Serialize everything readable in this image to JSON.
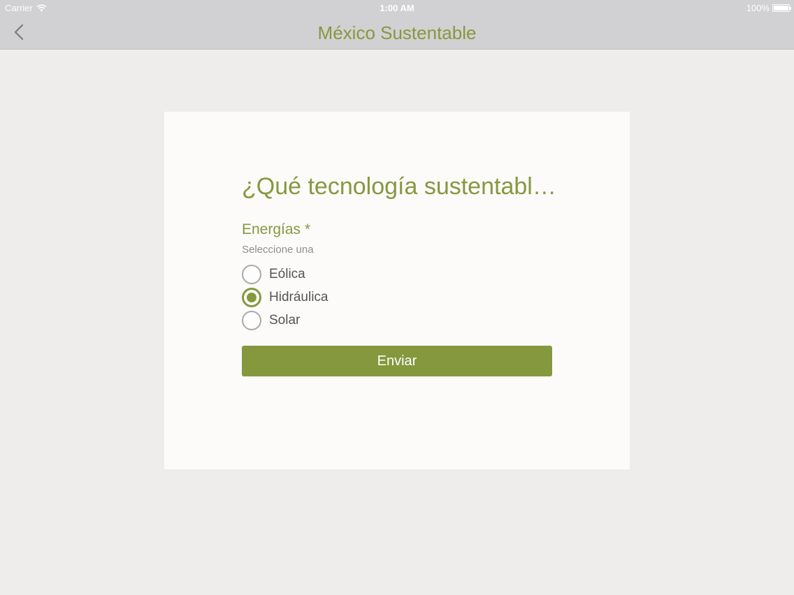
{
  "status_bar": {
    "carrier": "Carrier",
    "time": "1:00 AM",
    "battery": "100%",
    "icons": [
      "wifi-icon",
      "battery-icon"
    ]
  },
  "nav": {
    "title": "México Sustentable",
    "back_icon": "chevron-left-icon"
  },
  "form": {
    "question": "¿Qué tecnología sustentabl…",
    "field_label": "Energías *",
    "field_hint": "Seleccione una",
    "options": [
      {
        "label": "Eólica",
        "selected": false
      },
      {
        "label": "Hidráulica",
        "selected": true
      },
      {
        "label": "Solar",
        "selected": false
      }
    ],
    "submit_label": "Enviar"
  },
  "colors": {
    "accent": "#86983e",
    "nav_background": "#d1d0d2",
    "page_background": "#efedeb",
    "card_background": "#fcfbfa"
  }
}
